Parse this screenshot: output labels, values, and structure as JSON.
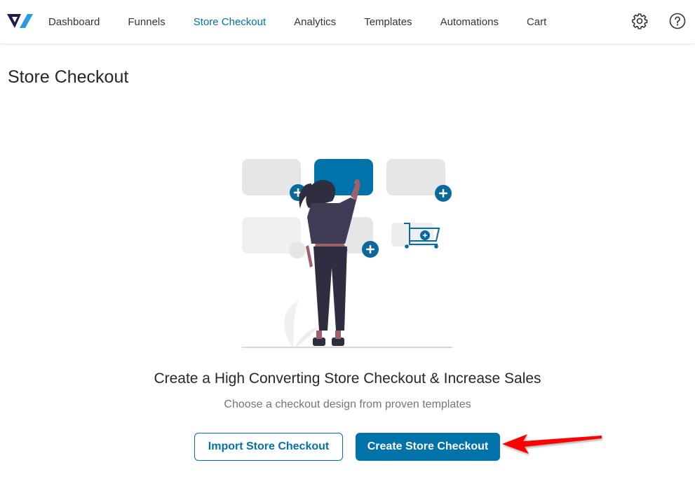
{
  "header": {
    "logo": "brand-logo",
    "nav": [
      {
        "label": "Dashboard",
        "active": false
      },
      {
        "label": "Funnels",
        "active": false
      },
      {
        "label": "Store Checkout",
        "active": true
      },
      {
        "label": "Analytics",
        "active": false
      },
      {
        "label": "Templates",
        "active": false
      },
      {
        "label": "Automations",
        "active": false
      },
      {
        "label": "Cart",
        "active": false
      }
    ],
    "icons": [
      "gear-icon",
      "help-icon"
    ]
  },
  "page": {
    "title": "Store Checkout"
  },
  "empty_state": {
    "illustration": "woman-arranging-checkout-blocks",
    "headline": "Create a High Converting Store Checkout & Increase Sales",
    "subline": "Choose a checkout design from proven templates",
    "import_label": "Import Store Checkout",
    "create_label": "Create Store Checkout"
  },
  "annotation": {
    "arrow_color": "#ff0000",
    "points_to": "create-store-checkout-button"
  },
  "colors": {
    "accent": "#0073aa",
    "text": "#23282d",
    "muted": "#757575"
  }
}
